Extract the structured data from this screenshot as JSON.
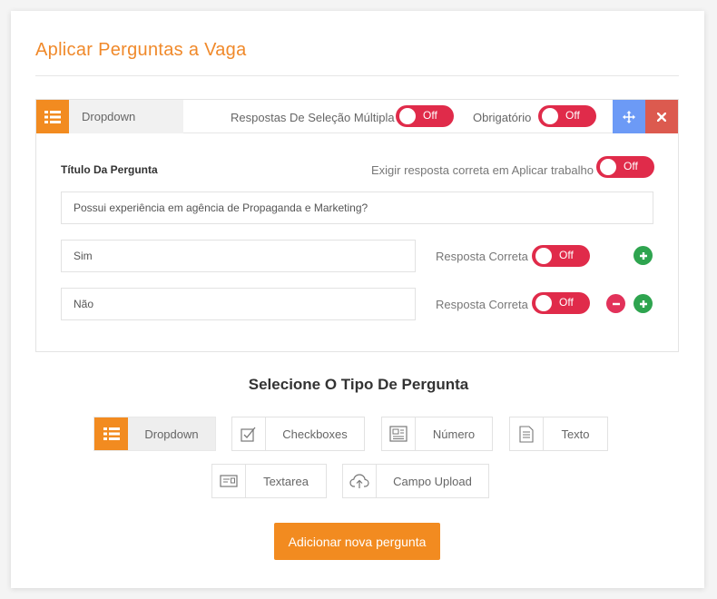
{
  "page_title": "Aplicar Perguntas a Vaga",
  "question": {
    "type_label": "Dropdown",
    "multi_select_label": "Respostas De Seleção Múltipla",
    "multi_select_toggle": "Off",
    "required_label": "Obrigatório",
    "required_toggle": "Off",
    "title_label": "Título Da Pergunta",
    "exigir_label": "Exigir resposta correta em Aplicar trabalho",
    "exigir_toggle": "Off",
    "title_value": "Possui experiência em agência de Propaganda e Marketing?",
    "answers": [
      {
        "value": "Sim",
        "correct_label": "Resposta Correta",
        "correct_toggle": "Off"
      },
      {
        "value": "Não",
        "correct_label": "Resposta Correta",
        "correct_toggle": "Off"
      }
    ]
  },
  "type_section": {
    "title": "Selecione O Tipo De Pergunta",
    "types": [
      {
        "label": "Dropdown",
        "icon": "list-icon",
        "active": true
      },
      {
        "label": "Checkboxes",
        "icon": "checkbox-icon",
        "active": false
      },
      {
        "label": "Número",
        "icon": "number-icon",
        "active": false
      },
      {
        "label": "Texto",
        "icon": "text-icon",
        "active": false
      },
      {
        "label": "Textarea",
        "icon": "textarea-icon",
        "active": false
      },
      {
        "label": "Campo Upload",
        "icon": "upload-icon",
        "active": false
      }
    ]
  },
  "add_button": "Adicionar nova pergunta",
  "colors": {
    "accent": "#f28b20",
    "toggle_off": "#e02b4a",
    "move_button": "#6c9af6",
    "close_button": "#dc5a4f",
    "add_circle": "#2ea44f",
    "remove_circle": "#e2325a"
  }
}
